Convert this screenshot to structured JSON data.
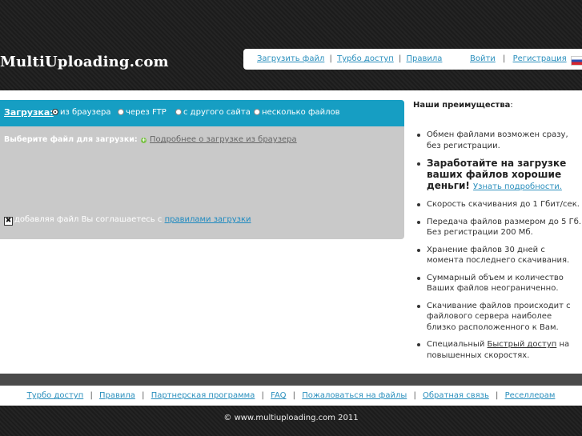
{
  "header": {
    "logo": "MultiUploading.com",
    "nav_left": [
      "Загрузить файл",
      "Турбо доступ",
      "Правила"
    ],
    "nav_right": [
      "Войти",
      "Регистрация"
    ],
    "separator": "|"
  },
  "upload": {
    "title": "Загрузка:",
    "options": [
      "из браузера",
      "через FTP",
      "с другого сайта",
      "несколько файлов"
    ],
    "selected": "из браузера",
    "choose_label": "Выберите файл для загрузки:",
    "more_link": "Подробнее о загрузке из браузера",
    "agree_text": "добавляя файл Вы соглашаетесь с",
    "agree_link": "правилами загрузки"
  },
  "advantages": {
    "title": "Наши преимущества",
    "title_suffix": ":",
    "items": [
      "Обмен файлами возможен сразу, без регистрации.",
      "Заработайте на загрузке ваших файлов хорошие деньги!",
      "Скорость скачивания до 1 Гбит/сек.",
      "Передача файлов размером до 5 Гб. Без регистрации 200 Мб.",
      "Хранение файлов 30 дней с момента последнего скачивания.",
      "Суммарный объем и количество Ваших файлов неограниченно.",
      "Скачивание файлов происходит с файлового сервера наиболее близко расположенного к Вам.",
      "Специальный"
    ],
    "earn_link": "Узнать подробности.",
    "turbo_link": "Быстрый доступ",
    "turbo_suffix": "на повышенных скоростях."
  },
  "footer": {
    "links": [
      "Турбо доступ",
      "Правила",
      "Партнерская программа",
      "FAQ",
      "Пожаловаться на файлы",
      "Обратная связь",
      "Реселлерам"
    ],
    "copyright": "© www.multiuploading.com 2011"
  },
  "colors": {
    "accent": "#169ec3",
    "link": "#2a8fbd",
    "panel": "#c9c9c9",
    "header_bg": "#1c1c1c"
  }
}
